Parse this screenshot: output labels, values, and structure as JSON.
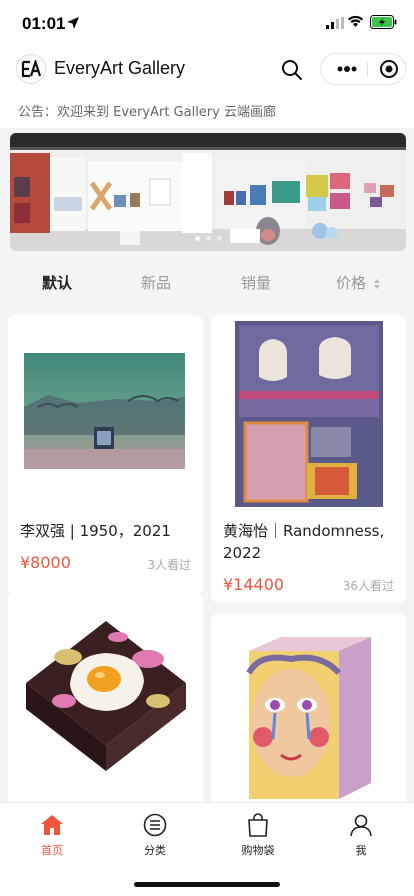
{
  "status": {
    "time": "01:01"
  },
  "header": {
    "title": "EveryArt Gallery",
    "logo_text": "EA"
  },
  "notice": {
    "text": "公告：欢迎来到 EveryArt Gallery 云端画廊"
  },
  "banner": {
    "count": 3,
    "active_index": 0
  },
  "sort_tabs": [
    {
      "label": "默认"
    },
    {
      "label": "新品"
    },
    {
      "label": "销量"
    },
    {
      "label": "价格"
    }
  ],
  "products": [
    {
      "title": "李双强 | 1950，2021",
      "price": "¥8000",
      "views": "3人看过"
    },
    {
      "title": "黄海怡｜Randomness, 2022",
      "price": "¥14400",
      "views": "36人看过"
    },
    {
      "title": "",
      "price": "",
      "views": ""
    },
    {
      "title": "",
      "price": "",
      "views": ""
    }
  ],
  "tab_bar": [
    {
      "label": "首页",
      "icon": "home-icon"
    },
    {
      "label": "分类",
      "icon": "list-icon"
    },
    {
      "label": "购物袋",
      "icon": "bag-icon"
    },
    {
      "label": "我",
      "icon": "user-icon"
    }
  ],
  "colors": {
    "accent": "#f0563e",
    "background": "#f4f4f4"
  }
}
